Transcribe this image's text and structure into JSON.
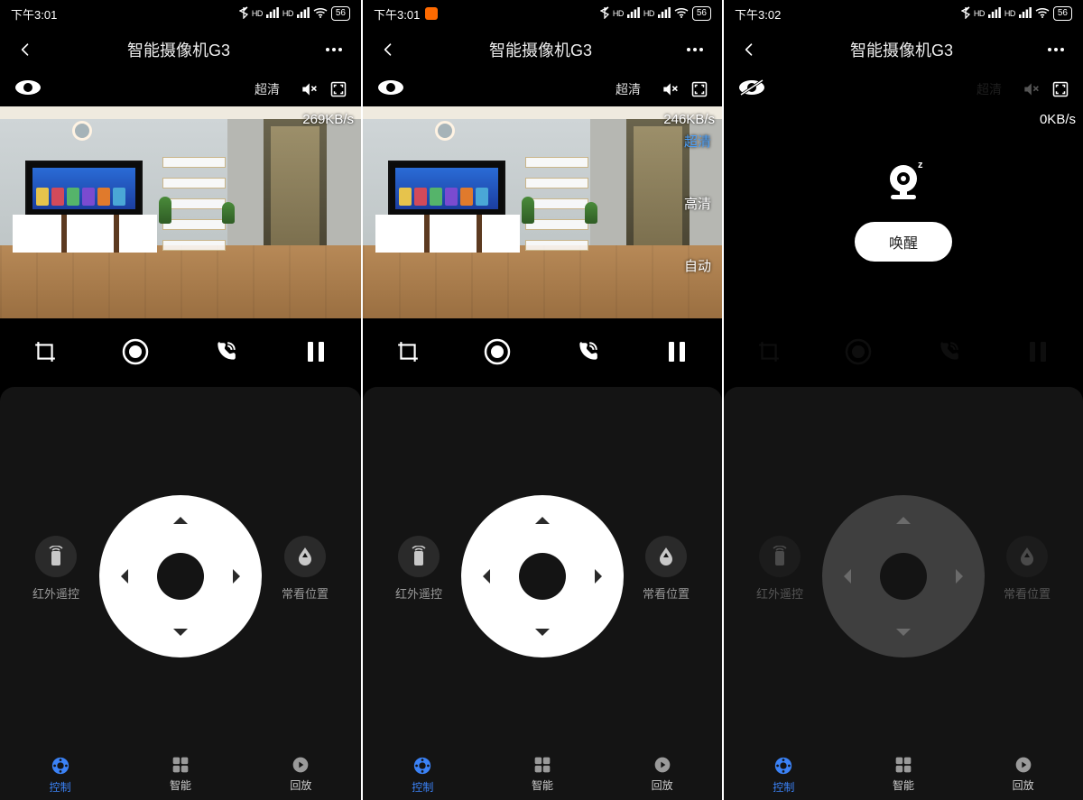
{
  "screens": [
    {
      "status": {
        "time": "下午3:01",
        "battery": "56",
        "orange_app": false
      },
      "title": "智能摄像机G3",
      "quality_label": "超清",
      "quality_disabled": false,
      "bandwidth": "269KB/s",
      "sleeping": false,
      "show_res_menu": false,
      "actions_dim": false,
      "joy_dim": false,
      "side_left": "红外遥控",
      "side_right": "常看位置",
      "tabs": {
        "control": "控制",
        "smart": "智能",
        "replay": "回放"
      }
    },
    {
      "status": {
        "time": "下午3:01",
        "battery": "56",
        "orange_app": true
      },
      "title": "智能摄像机G3",
      "quality_label": "超清",
      "quality_disabled": false,
      "bandwidth": "246KB/s",
      "sleeping": false,
      "show_res_menu": true,
      "res_options": {
        "uhd": "超清",
        "hd": "高清",
        "auto": "自动"
      },
      "actions_dim": false,
      "joy_dim": false,
      "side_left": "红外遥控",
      "side_right": "常看位置",
      "tabs": {
        "control": "控制",
        "smart": "智能",
        "replay": "回放"
      }
    },
    {
      "status": {
        "time": "下午3:02",
        "battery": "56",
        "orange_app": false
      },
      "title": "智能摄像机G3",
      "quality_label": "超清",
      "quality_disabled": true,
      "bandwidth": "0KB/s",
      "sleeping": true,
      "wake_label": "唤醒",
      "show_res_menu": false,
      "actions_dim": true,
      "joy_dim": true,
      "side_left": "红外遥控",
      "side_right": "常看位置",
      "tabs": {
        "control": "控制",
        "smart": "智能",
        "replay": "回放"
      }
    }
  ]
}
